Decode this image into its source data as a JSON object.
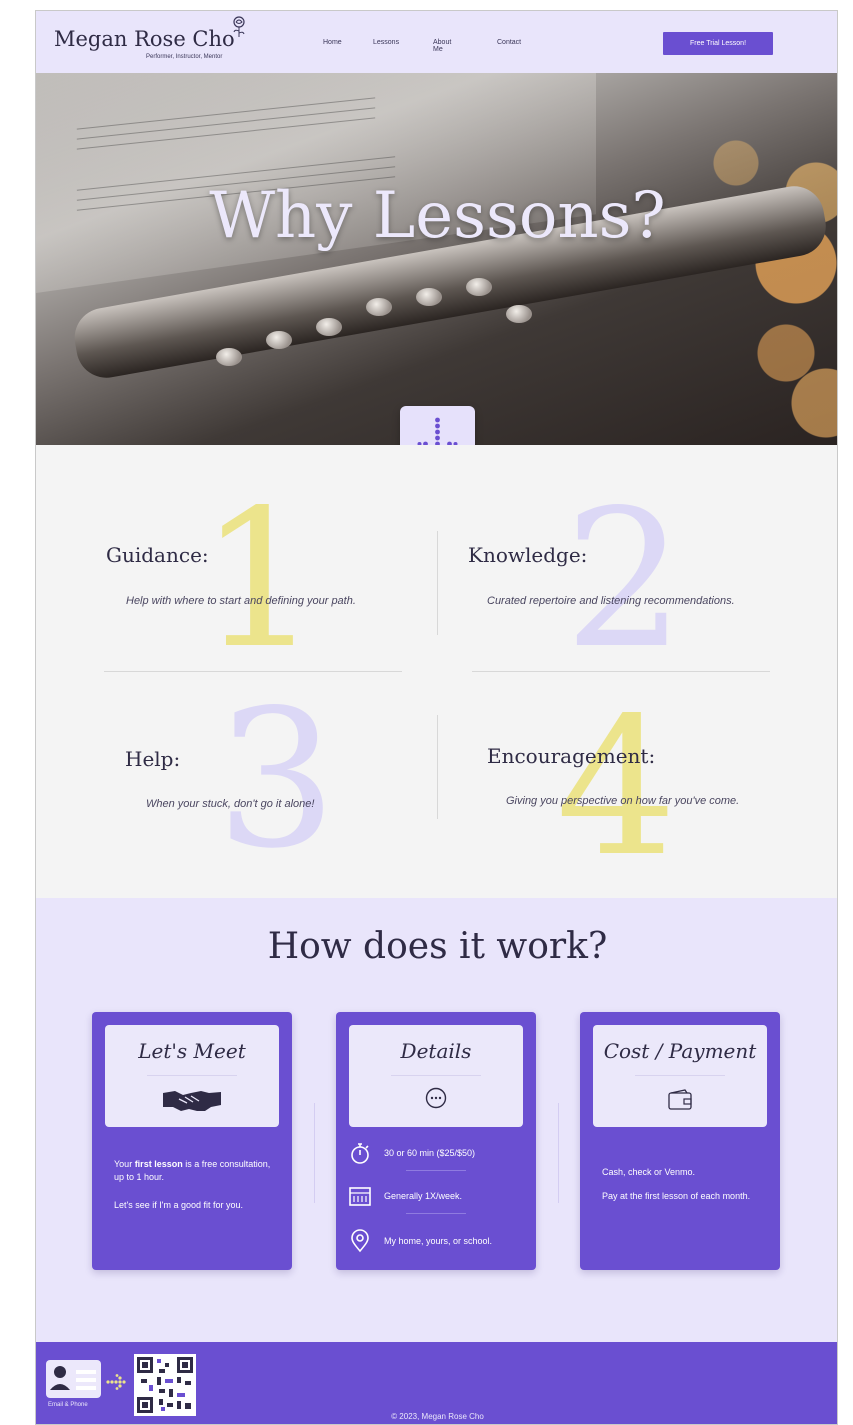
{
  "header": {
    "logo_name": "Megan Rose Cho",
    "logo_sub": "Performer, Instructor, Mentor",
    "nav": [
      "Home",
      "Lessons",
      "About Me",
      "Contact"
    ],
    "cta_label": "Free Trial Lesson!"
  },
  "hero": {
    "title": "Why Lessons?"
  },
  "why": {
    "items": [
      {
        "number": "1",
        "title": "Guidance:",
        "desc": "Help with where to start and defining your path."
      },
      {
        "number": "2",
        "title": "Knowledge:",
        "desc": "Curated repertoire and listening recommendations."
      },
      {
        "number": "3",
        "title": "Help:",
        "desc": "When your stuck, don't go it alone!"
      },
      {
        "number": "4",
        "title": "Encouragement:",
        "desc": "Giving you perspective on how far you've come."
      }
    ],
    "colors": {
      "yellow": "#ece48c",
      "lavender": "#dcd8f6"
    }
  },
  "how": {
    "title": "How does it work?",
    "cards": [
      {
        "title": "Let's Meet",
        "icon": "handshake-icon",
        "lines": [
          {
            "bold_lead": "",
            "pre": "Your ",
            "bold": "first lesson",
            "post": " is a free consultation, up to 1 hour."
          },
          {
            "text": "Let's see if I'm a good fit for you."
          }
        ]
      },
      {
        "title": "Details",
        "icon": "ellipsis-circle-icon",
        "rows": [
          {
            "icon": "stopwatch-icon",
            "text": "30 or 60 min ($25/$50)"
          },
          {
            "icon": "calendar-icon",
            "text": "Generally 1X/week."
          },
          {
            "icon": "location-pin-icon",
            "text": "My home, yours, or school."
          }
        ]
      },
      {
        "title": "Cost / Payment",
        "icon": "wallet-icon",
        "lines": [
          {
            "text": "Cash, check or Venmo."
          },
          {
            "text": "Pay at the first lesson of each month."
          }
        ]
      }
    ]
  },
  "footer": {
    "contact_card_label": "Email & Phone",
    "copyright": "© 2023, Megan Rose Cho"
  },
  "accent": "#6a4fd1",
  "header_bg": "#e9e5fb"
}
